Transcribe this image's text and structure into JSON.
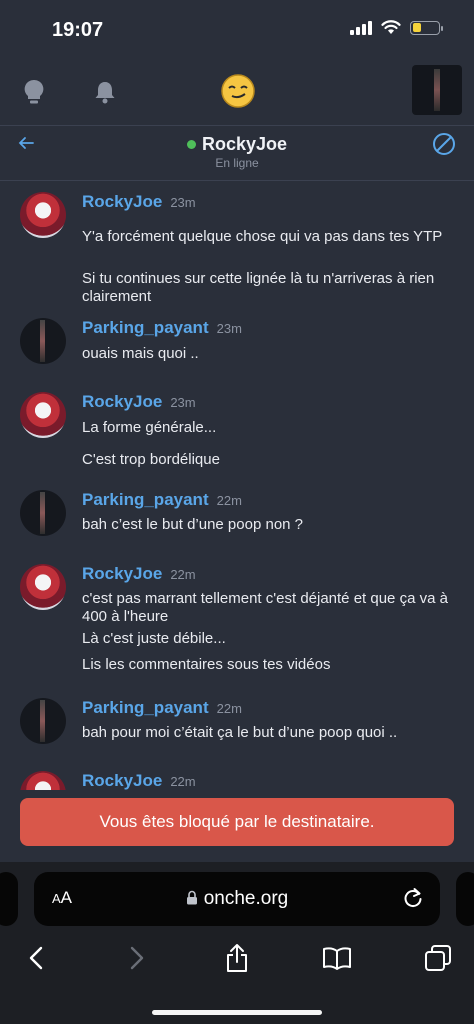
{
  "status": {
    "time": "19:07",
    "battery_level": 0.3
  },
  "chat": {
    "name": "RockyJoe",
    "status": "En ligne"
  },
  "messages": [
    {
      "author": "RockyJoe",
      "time": "23m",
      "avatar": "rocky",
      "lines": [
        "Y'a forcément quelque chose qui va pas dans tes YTP",
        "Si tu continues sur cette lignée là tu n'arriveras à rien clairement"
      ]
    },
    {
      "author": "Parking_payant",
      "time": "23m",
      "avatar": "parking",
      "lines": [
        "ouais mais quoi .."
      ]
    },
    {
      "author": "RockyJoe",
      "time": "23m",
      "avatar": "rocky",
      "lines": [
        "La forme générale...",
        "C'est trop bordélique"
      ]
    },
    {
      "author": "Parking_payant",
      "time": "22m",
      "avatar": "parking",
      "lines": [
        "bah c’est le but d’une poop non ?"
      ]
    },
    {
      "author": "RockyJoe",
      "time": "22m",
      "avatar": "rocky",
      "lines": [
        "c'est pas marrant tellement c'est déjanté et que ça va à 400 à l'heure",
        "Là c'est juste débile...",
        "Lis les commentaires sous tes vidéos"
      ]
    },
    {
      "author": "Parking_payant",
      "time": "22m",
      "avatar": "parking",
      "lines": [
        "bah pour moi c’était ça le but d’une poop quoi .."
      ]
    },
    {
      "author": "RockyJoe",
      "time": "22m",
      "avatar": "rocky",
      "lines": []
    }
  ],
  "banner": {
    "text": "Vous êtes bloqué par le destinataire."
  },
  "browser": {
    "aa_label_small": "A",
    "aa_label_large": "A",
    "url": "onche.org"
  },
  "colors": {
    "accent": "#5aa6e8",
    "banner": "#d9574a",
    "online": "#4fbf5a"
  }
}
